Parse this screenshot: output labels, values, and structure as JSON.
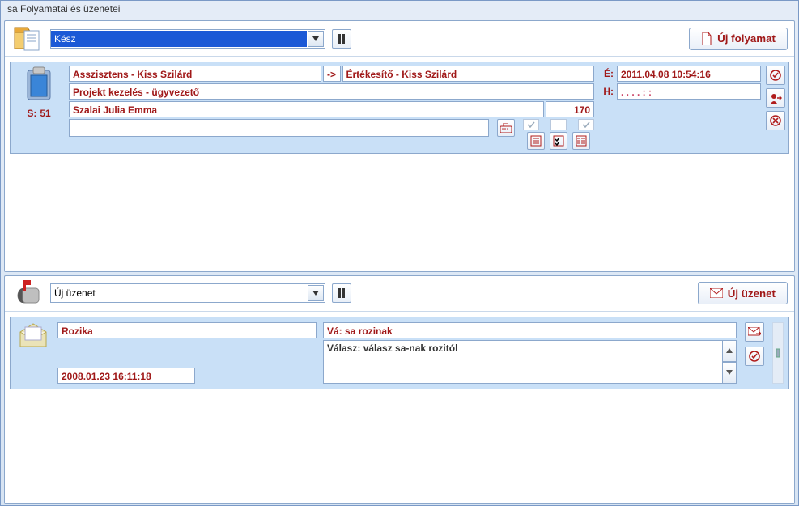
{
  "window": {
    "title": "sa Folyamatai és üzenetei"
  },
  "processes": {
    "status_dropdown": "Kész",
    "new_button": "Új folyamat",
    "card": {
      "s_label": "S:",
      "s_value": "51",
      "assistant": "Asszisztens - Kiss Szilárd",
      "arrow": "->",
      "salesperson": "Értékesítő - Kiss Szilárd",
      "project": "Projekt kezelés - ügyvezető",
      "contact": "Szalai Julia Emma",
      "number": "170",
      "e_label": "É:",
      "e_value": "2011.04.08 10:54:16",
      "h_label": "H:",
      "h_value": ". .   . .     :   :"
    }
  },
  "messages": {
    "status_dropdown": "Új üzenet",
    "new_button": "Új üzenet",
    "card": {
      "from": "Rozika",
      "date": "2008.01.23 16:11:18",
      "subject": "Vá: sa rozinak",
      "body": "Válasz: válasz sa-nak rozitól"
    }
  }
}
